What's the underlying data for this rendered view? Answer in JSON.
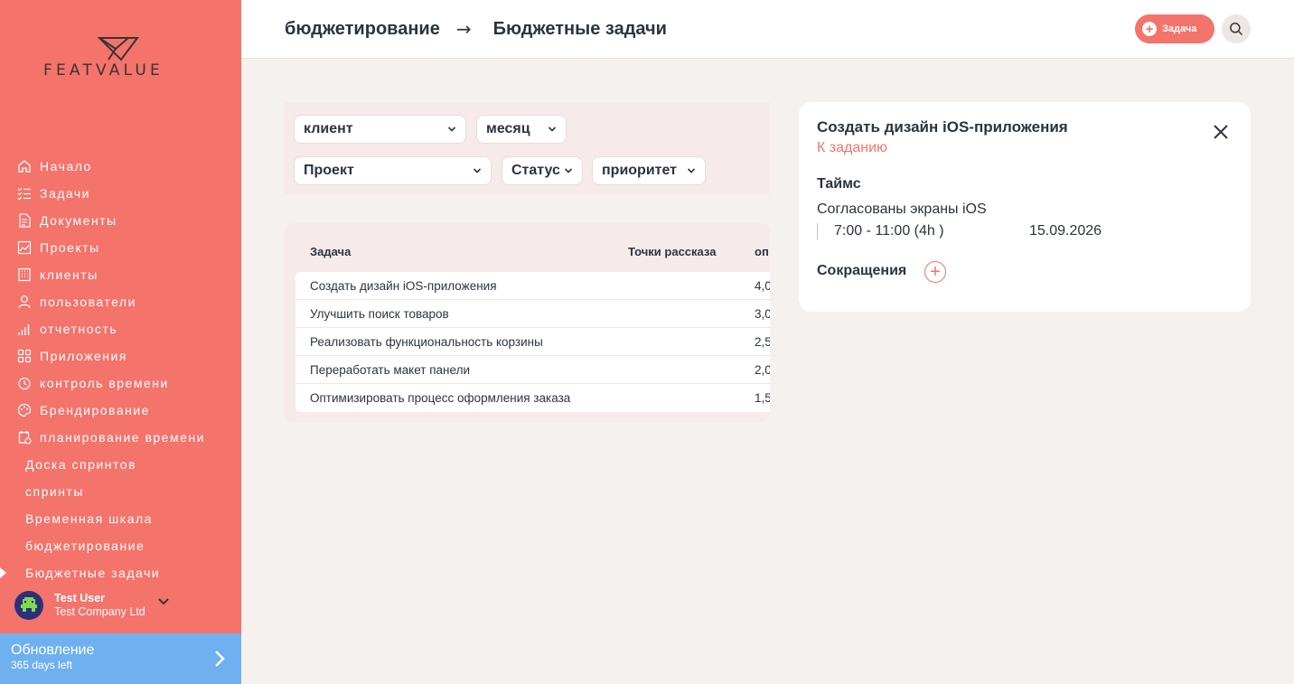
{
  "app": {
    "logo_text": "FEATVALUE"
  },
  "sidebar": {
    "items": [
      {
        "label": "Начало",
        "icon": "home-icon"
      },
      {
        "label": "Задачи",
        "icon": "tasks-icon"
      },
      {
        "label": "Документы",
        "icon": "documents-icon"
      },
      {
        "label": "Проекты",
        "icon": "projects-icon"
      },
      {
        "label": "клиенты",
        "icon": "clients-icon"
      },
      {
        "label": "пользователи",
        "icon": "users-icon"
      },
      {
        "label": "отчетность",
        "icon": "reports-icon"
      },
      {
        "label": "Приложения",
        "icon": "apps-icon"
      },
      {
        "label": "контроль времени",
        "icon": "timer-icon"
      },
      {
        "label": "Брендирование",
        "icon": "palette-icon"
      },
      {
        "label": "планирование времени",
        "icon": "schedule-icon"
      }
    ],
    "subitems": [
      {
        "label": "Доска спринтов"
      },
      {
        "label": "спринты"
      },
      {
        "label": "Временная шкала"
      },
      {
        "label": "бюджетирование"
      },
      {
        "label": "Бюджетные задачи",
        "active": true
      }
    ],
    "user": {
      "name": "Test User",
      "company": "Test Company Ltd"
    },
    "upgrade": {
      "title": "Обновление",
      "subtitle": "365 days left"
    }
  },
  "header": {
    "breadcrumb_parent": "бюджетирование",
    "breadcrumb_arrow": "→",
    "breadcrumb_current": "Бюджетные задачи",
    "task_button_label": "Задача"
  },
  "filters": {
    "client": "клиент",
    "month": "месяц",
    "project": "Проект",
    "status": "Статус",
    "priority": "приоритет"
  },
  "table": {
    "columns": [
      "Задача",
      "Точки рассказа",
      "оп"
    ],
    "rows": [
      {
        "task": "Создать дизайн iOS-приложения",
        "points": "",
        "value": "4,0"
      },
      {
        "task": "Улучшить поиск товаров",
        "points": "",
        "value": "3,0"
      },
      {
        "task": "Реализовать функциональность корзины",
        "points": "",
        "value": "2,5"
      },
      {
        "task": "Переработать макет панели",
        "points": "",
        "value": "2,0"
      },
      {
        "task": "Оптимизировать процесс оформления заказа",
        "points": "",
        "value": "1,5"
      }
    ]
  },
  "detail": {
    "title": "Создать дизайн iOS-приложения",
    "link": "К заданию",
    "times_heading": "Таймс",
    "entry_description": "Согласованы экраны iOS",
    "entry_time": "7:00 - 11:00 (4h )",
    "entry_date": "15.09.2026",
    "cuts_heading": "Сокращения"
  },
  "colors": {
    "accent": "#f4736b",
    "upgrade": "#6eb0f0",
    "text": "#2b3441"
  }
}
